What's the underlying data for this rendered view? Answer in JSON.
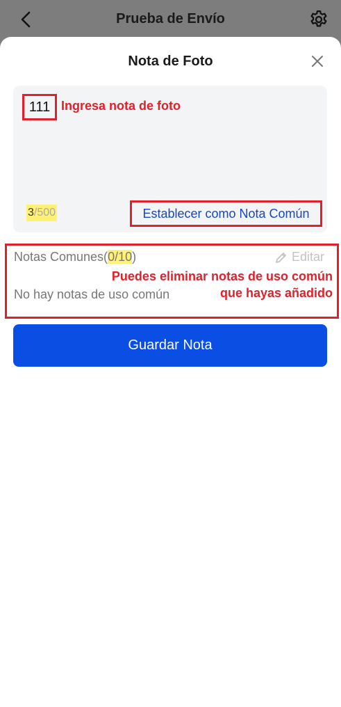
{
  "header": {
    "title": "Prueba de Envío",
    "back_icon": "chevron-left-icon",
    "settings_icon": "gear-icon"
  },
  "sheet": {
    "title": "Nota de Foto",
    "close_icon": "close-icon",
    "note": {
      "value": "111",
      "annotation": "Ingresa nota de foto",
      "count_current": "3",
      "count_max": "/500"
    },
    "set_common_label": "Establecer como Nota Común",
    "common": {
      "label_prefix": "Notas Comunes(",
      "count": "0/10",
      "label_suffix": ")",
      "edit_label": "Editar",
      "edit_icon": "pencil-icon",
      "annotation_line1": "Puedes eliminar notas de uso común",
      "annotation_line2": "que hayas añadido",
      "empty_text": "No hay notas de uso común"
    },
    "save_label": "Guardar Nota"
  },
  "colors": {
    "accent": "#0a4ee4",
    "link": "#1547c7",
    "highlight_box": "#e0212b",
    "highlight_marker": "#fff176"
  }
}
